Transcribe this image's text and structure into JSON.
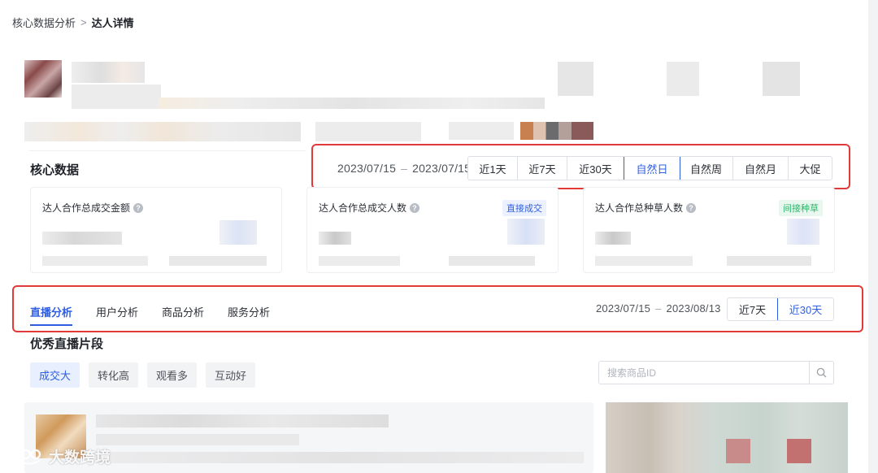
{
  "breadcrumb": {
    "parent": "核心数据分析",
    "separator": ">",
    "current": "达人详情"
  },
  "core": {
    "title": "核心数据",
    "range": {
      "start": "2023/07/15",
      "end": "2023/07/15",
      "dash": "–"
    },
    "periods": [
      "近1天",
      "近7天",
      "近30天",
      "自然日",
      "自然周",
      "自然月",
      "大促"
    ],
    "active_period": "自然日",
    "cards": [
      {
        "title": "达人合作总成交金额",
        "badge": ""
      },
      {
        "title": "达人合作总成交人数",
        "badge": "直接成交"
      },
      {
        "title": "达人合作总种草人数",
        "badge": "间接种草"
      }
    ]
  },
  "analysis": {
    "tabs": [
      "直播分析",
      "用户分析",
      "商品分析",
      "服务分析"
    ],
    "active_tab": "直播分析",
    "range": {
      "start": "2023/07/15",
      "end": "2023/08/13",
      "dash": "–"
    },
    "periods": [
      "近7天",
      "近30天"
    ],
    "active_period": "近30天"
  },
  "segments": {
    "title": "优秀直播片段",
    "filters": [
      "成交大",
      "转化高",
      "观看多",
      "互动好"
    ],
    "active_filter": "成交大",
    "search_placeholder": "搜索商品ID"
  },
  "watermark": {
    "text": "大数跨境"
  },
  "colors": {
    "accent": "#2f5fe0",
    "highlight_border": "#e23a3a",
    "green": "#2fb36b"
  },
  "icons": {
    "question": "question-circle-icon",
    "search": "search-icon",
    "chevron": "chevron-right-icon"
  }
}
